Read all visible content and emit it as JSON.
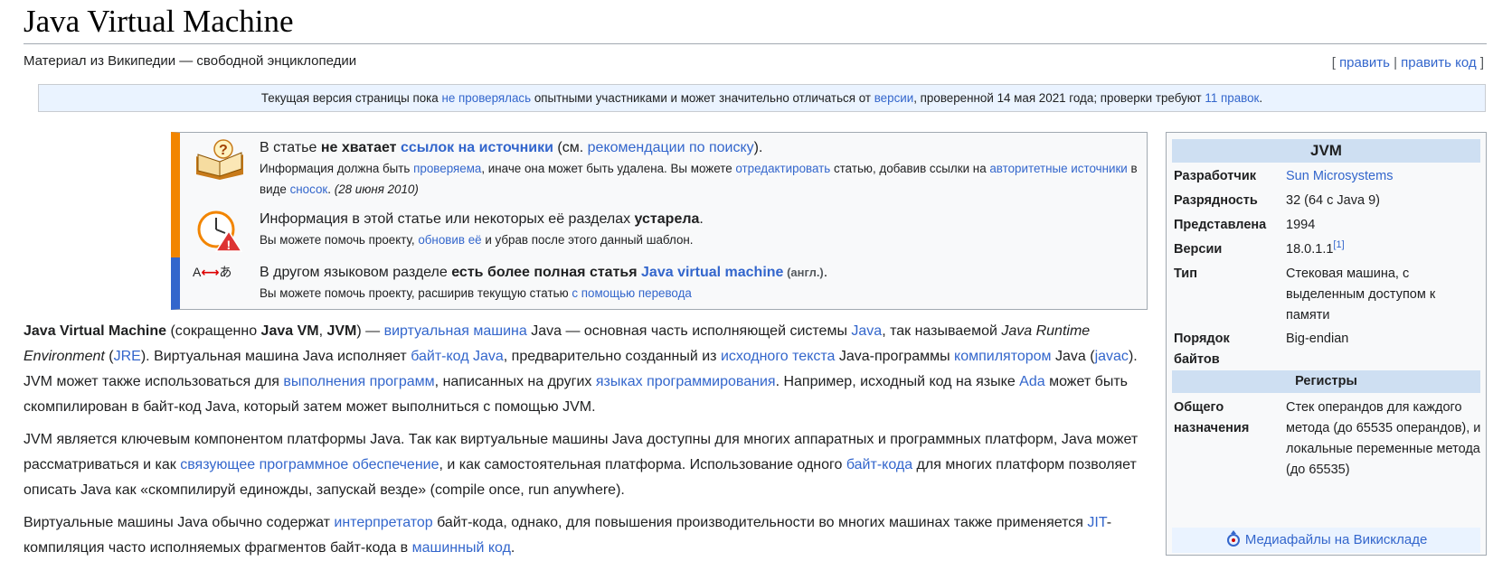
{
  "header": {
    "title": "Java Virtual Machine",
    "tagline": "Материал из Википедии — свободной энциклопедии",
    "edit_open": "[ ",
    "edit": "править",
    "edit_sep": " | ",
    "edit_code": "править код",
    "edit_close": " ]"
  },
  "review": {
    "t1": "Текущая версия страницы пока ",
    "l1": "не проверялась",
    "t2": " опытными участниками и может значительно отличаться от ",
    "l2": "версии",
    "t3": ", проверенной 14 мая 2021 года; проверки требуют ",
    "l3": "11 правок",
    "t4": "."
  },
  "notice1": {
    "t1": "В статье ",
    "b1": "не хватает ",
    "l1": "ссылок на источники",
    "t2": " (см. ",
    "l2": "рекомендации по поиску",
    "t3": ").",
    "s1": "Информация должна быть ",
    "sl1": "проверяема",
    "s2": ", иначе она может быть удалена. Вы можете ",
    "sl2": "отредактировать",
    "s3": " статью, добавив ссылки на ",
    "sl3": "авторитетные источники",
    "s4": " в виде ",
    "sl4": "сносок",
    "s5": ". ",
    "date": "(28 июня 2010)"
  },
  "notice2": {
    "t1": "Информация в этой статье или некоторых её разделах ",
    "b1": "устарела",
    "t2": ".",
    "s1": "Вы можете помочь проекту, ",
    "sl1": "обновив её",
    "s2": " и убрав после этого данный шаблон."
  },
  "notice3": {
    "icon_a": "A",
    "icon_arrow": "⟷",
    "icon_b": "あ",
    "t1": "В другом языковом разделе ",
    "b1": "есть более полная статья ",
    "l1": "Java virtual machine",
    "lang": " (англ.)",
    "t2": ".",
    "s1": "Вы можете помочь проекту, расширив текущую статью ",
    "sl1": "с помощью перевода"
  },
  "para1": {
    "b1": "Java Virtual Machine",
    "t1": " (сокращенно ",
    "b2": "Java VM",
    "t2": ", ",
    "b3": "JVM",
    "t3": ") — ",
    "l1": "виртуальная машина",
    "t4": " Java — основная часть исполняющей системы ",
    "l2": "Java",
    "t5": ", так называемой ",
    "i1": "Java Runtime Environment",
    "t6": " (",
    "l3": "JRE",
    "t7": "). Виртуальная машина Java исполняет ",
    "l4": "байт-код Java",
    "t8": ", предварительно созданный из ",
    "l5": "исходного текста",
    "t9": " Java-программы ",
    "l6": "компилятором",
    "t10": " Java (",
    "l7": "javac",
    "t11": "). JVM может также использоваться для ",
    "l8": "выполнения программ",
    "t12": ", написанных на других ",
    "l9": "языках программирования",
    "t13": ". Например, исходный код на языке ",
    "l10": "Ada",
    "t14": " может быть скомпилирован в байт-код Java, который затем может выполниться с помощью JVM."
  },
  "para2": {
    "t1": "JVM является ключевым компонентом платформы Java. Так как виртуальные машины Java доступны для многих аппаратных и программных платформ, Java может рассматриваться и как ",
    "l1": "связующее программное обеспечение",
    "t2": ", и как самостоятельная платформа. Использование одного ",
    "l2": "байт-кода",
    "t3": " для многих платформ позволяет описать Java как «скомпилируй единожды, запускай везде» (compile once, run anywhere)."
  },
  "para3": {
    "t1": "Виртуальные машины Java обычно содержат ",
    "l1": "интерпретатор",
    "t2": " байт-кода, однако, для повышения производительности во многих машинах также применяется ",
    "l2": "JIT",
    "t3": "-компиляция часто исполняемых фрагментов байт-кода в ",
    "l3": "машинный код",
    "t4": "."
  },
  "infobox": {
    "title": "JVM",
    "rows": [
      {
        "key": "Разработчик",
        "value": "Sun Microsystems"
      },
      {
        "key": "Разрядность",
        "value": "32 (64 с Java 9)"
      },
      {
        "key": "Представлена",
        "value": "1994"
      },
      {
        "key": "Версии",
        "value": "18.0.1.1",
        "ref": "[1]"
      },
      {
        "key": "Тип",
        "value": "Стековая машина, с выделенным доступом к памяти"
      },
      {
        "key": "Порядок байтов",
        "value": "Big-endian"
      }
    ],
    "section": "Регистры",
    "reg_key": "Общего назначения",
    "reg_value": "Стек операндов для каждого метода (до 65535 операндов), и локальные переменные метода (до 65535)",
    "commons": "Медиафайлы на Викискладе"
  }
}
